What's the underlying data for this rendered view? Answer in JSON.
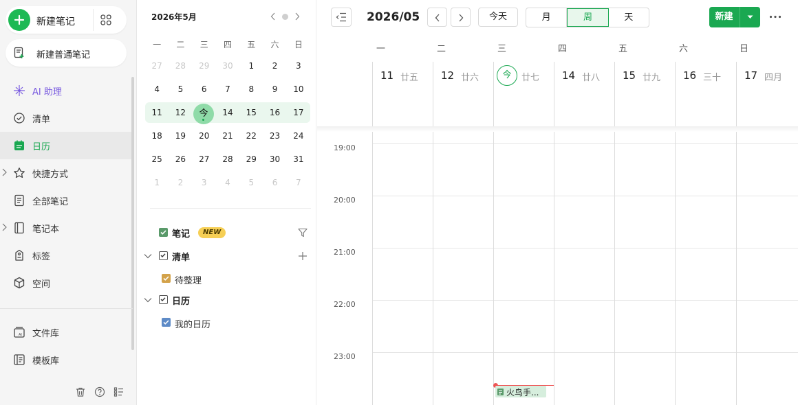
{
  "sidebar": {
    "new_note": "新建笔记",
    "new_plain_note": "新建普通笔记",
    "items": [
      {
        "label": "AI 助理",
        "icon": "ai-sparkle-icon"
      },
      {
        "label": "清单",
        "icon": "check-circle-icon"
      },
      {
        "label": "日历",
        "icon": "calendar-icon"
      },
      {
        "label": "快捷方式",
        "icon": "star-icon"
      },
      {
        "label": "全部笔记",
        "icon": "notes-icon"
      },
      {
        "label": "笔记本",
        "icon": "notebook-icon"
      },
      {
        "label": "标签",
        "icon": "tag-icon"
      },
      {
        "label": "空间",
        "icon": "cube-icon"
      },
      {
        "label": "文件库",
        "icon": "file-library-icon"
      },
      {
        "label": "模板库",
        "icon": "template-icon"
      }
    ],
    "active_item": "日历"
  },
  "mini_calendar": {
    "title": "2026年5月",
    "weekdays": [
      "一",
      "二",
      "三",
      "四",
      "五",
      "六",
      "日"
    ],
    "weeks": [
      [
        "27",
        "28",
        "29",
        "30",
        "1",
        "2",
        "3"
      ],
      [
        "4",
        "5",
        "6",
        "7",
        "8",
        "9",
        "10"
      ],
      [
        "11",
        "12",
        "今",
        "14",
        "15",
        "16",
        "17"
      ],
      [
        "18",
        "19",
        "20",
        "21",
        "22",
        "23",
        "24"
      ],
      [
        "25",
        "26",
        "27",
        "28",
        "29",
        "30",
        "31"
      ],
      [
        "1",
        "2",
        "3",
        "4",
        "5",
        "6",
        "7"
      ]
    ],
    "today_label": "今"
  },
  "layers": {
    "notes": "笔记",
    "new_badge": "NEW",
    "lists": "清单",
    "pending": "待整理",
    "calendar": "日历",
    "my_calendar": "我的日历"
  },
  "toolbar": {
    "title": "2026/05",
    "today": "今天",
    "views": [
      "月",
      "周",
      "天"
    ],
    "active_view": "周",
    "create": "新建"
  },
  "week": {
    "weekdays": [
      "一",
      "二",
      "三",
      "四",
      "五",
      "六",
      "日"
    ],
    "days": [
      {
        "num": "11",
        "lunar": "廿五"
      },
      {
        "num": "12",
        "lunar": "廿六"
      },
      {
        "num": "今",
        "lunar": "廿七"
      },
      {
        "num": "14",
        "lunar": "廿八"
      },
      {
        "num": "15",
        "lunar": "廿九"
      },
      {
        "num": "16",
        "lunar": "三十"
      },
      {
        "num": "17",
        "lunar": "四月"
      }
    ],
    "times": [
      "19:00",
      "20:00",
      "21:00",
      "22:00",
      "23:00"
    ]
  },
  "event": {
    "label": "火鸟手..."
  },
  "colors": {
    "accent": "#1aa851",
    "ai": "#7a5ce0",
    "now_line": "#e55555"
  }
}
